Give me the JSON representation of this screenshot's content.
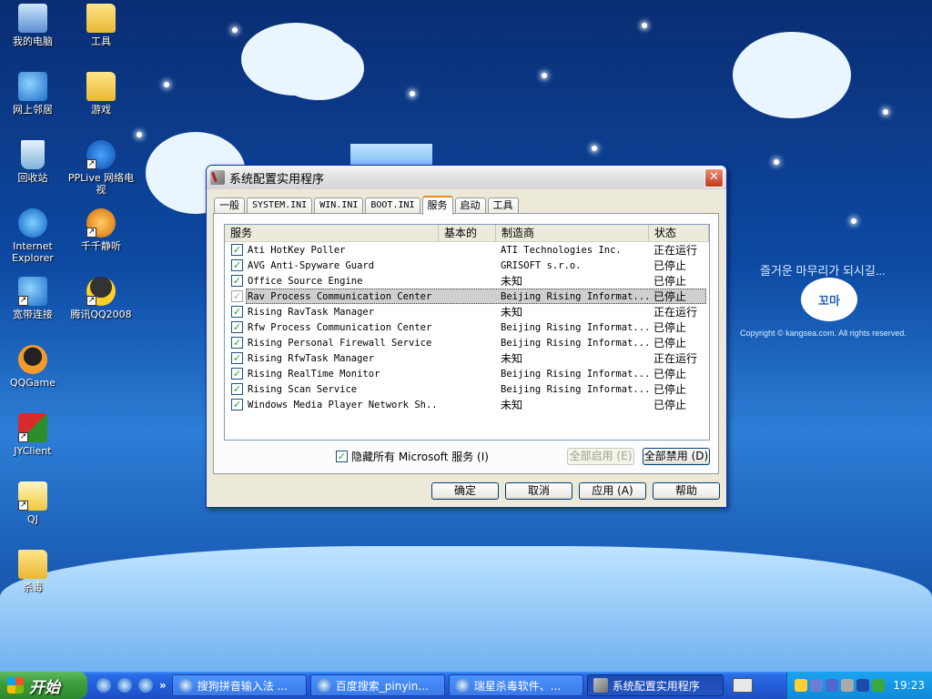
{
  "wallpaper": {
    "tagline": "즐거운 마무리가 되시길...",
    "badge_text": "꼬마",
    "copyright": "Copyright © kangsea.com. All rights reserved."
  },
  "desktop_icons": [
    {
      "label": "我的电脑",
      "icon": "computer-icon"
    },
    {
      "label": "工具",
      "icon": "folder-icon"
    },
    {
      "label": "网上邻居",
      "icon": "network-icon"
    },
    {
      "label": "游戏",
      "icon": "folder-icon"
    },
    {
      "label": "回收站",
      "icon": "recycle-bin-icon"
    },
    {
      "label": "PPLive 网络电视",
      "icon": "pplive-icon"
    },
    {
      "label": "Internet Explorer",
      "icon": "ie-icon"
    },
    {
      "label": "千千静听",
      "icon": "ttplayer-icon"
    },
    {
      "label": "宽带连接",
      "icon": "broadband-icon"
    },
    {
      "label": "腾讯QQ2008",
      "icon": "qq-icon"
    },
    {
      "label": "QQGame",
      "icon": "qqgame-icon"
    },
    {
      "label": "JYClient",
      "icon": "jyclient-icon"
    },
    {
      "label": "QJ",
      "icon": "qj-icon"
    },
    {
      "label": "杀毒",
      "icon": "folder-icon"
    }
  ],
  "dialog": {
    "title": "系统配置实用程序",
    "close_label": "✕",
    "tabs": [
      "一般",
      "SYSTEM.INI",
      "WIN.INI",
      "BOOT.INI",
      "服务",
      "启动",
      "工具"
    ],
    "active_tab": "服务",
    "columns": [
      "服务",
      "基本的",
      "制造商",
      "状态"
    ],
    "services": [
      {
        "name": "Ati HotKey Poller",
        "essential": "",
        "manufacturer": "ATI Technologies Inc.",
        "status": "正在运行",
        "checked": true
      },
      {
        "name": "AVG Anti-Spyware Guard",
        "essential": "",
        "manufacturer": "GRISOFT s.r.o.",
        "status": "已停止",
        "checked": true
      },
      {
        "name": "Office Source Engine",
        "essential": "",
        "manufacturer": "未知",
        "status": "已停止",
        "checked": true
      },
      {
        "name": "Rav Process Communication Center",
        "essential": "",
        "manufacturer": "Beijing Rising Informat...",
        "status": "已停止",
        "checked": true,
        "selected": true
      },
      {
        "name": "Rising RavTask Manager",
        "essential": "",
        "manufacturer": "未知",
        "status": "正在运行",
        "checked": true
      },
      {
        "name": "Rfw Process Communication Center",
        "essential": "",
        "manufacturer": "Beijing Rising Informat...",
        "status": "已停止",
        "checked": true
      },
      {
        "name": "Rising Personal Firewall Service",
        "essential": "",
        "manufacturer": "Beijing Rising Informat...",
        "status": "已停止",
        "checked": true
      },
      {
        "name": "Rising RfwTask Manager",
        "essential": "",
        "manufacturer": "未知",
        "status": "正在运行",
        "checked": true
      },
      {
        "name": "Rising RealTime Monitor",
        "essential": "",
        "manufacturer": "Beijing Rising Informat...",
        "status": "已停止",
        "checked": true
      },
      {
        "name": "Rising Scan Service",
        "essential": "",
        "manufacturer": "Beijing Rising Informat...",
        "status": "已停止",
        "checked": true
      },
      {
        "name": "Windows Media Player Network Sh...",
        "essential": "",
        "manufacturer": "未知",
        "status": "已停止",
        "checked": true
      }
    ],
    "hide_ms_label": "隐藏所有 Microsoft 服务 (I)",
    "hide_ms_checked": true,
    "enable_all_label": "全部启用 (E)",
    "disable_all_label": "全部禁用 (D)",
    "ok_label": "确定",
    "cancel_label": "取消",
    "apply_label": "应用 (A)",
    "help_label": "帮助"
  },
  "taskbar": {
    "start_label": "开始",
    "quicklaunch_overflow": "»",
    "tasks": [
      {
        "label": "搜狗拼音输入法 ...",
        "active": false
      },
      {
        "label": "百度搜索_pinyin...",
        "active": false
      },
      {
        "label": "瑞星杀毒软件、...",
        "active": false
      },
      {
        "label": "系统配置实用程序",
        "active": true
      }
    ],
    "clock": "19:23"
  }
}
